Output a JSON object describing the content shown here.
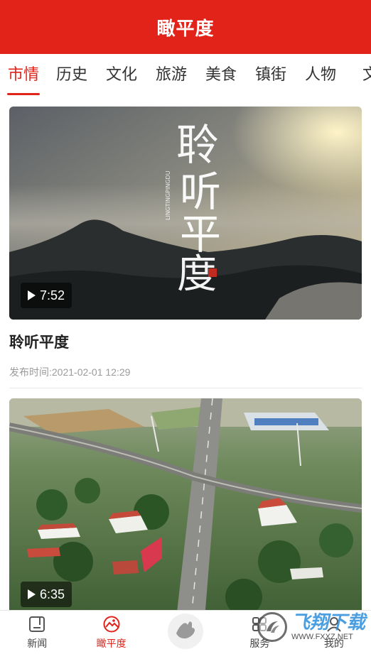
{
  "header": {
    "title": "瞰平度"
  },
  "tabs": [
    {
      "label": "市情",
      "active": true
    },
    {
      "label": "历史"
    },
    {
      "label": "文化"
    },
    {
      "label": "旅游"
    },
    {
      "label": "美食"
    },
    {
      "label": "镇街"
    },
    {
      "label": "人物"
    },
    {
      "label": "文"
    }
  ],
  "feed": [
    {
      "title": "聆听平度",
      "meta": "发布时间:2021-02-01 12:29",
      "duration": "7:52",
      "overlay_text": "聆听平度",
      "overlay_sub": "LINGTINGPINGDU"
    },
    {
      "duration": "6:35"
    }
  ],
  "bottom_nav": [
    {
      "label": "新闻",
      "icon": "news-icon"
    },
    {
      "label": "瞰平度",
      "icon": "camera-landscape-icon",
      "active": true
    },
    {
      "label": "",
      "icon": "hand-icon"
    },
    {
      "label": "服务",
      "icon": "service-icon"
    },
    {
      "label": "我的",
      "icon": "user-icon"
    }
  ],
  "watermark": {
    "main": "飞翔下载",
    "sub": "WWW.FXXZ.NET"
  },
  "colors": {
    "accent": "#e2231a"
  }
}
